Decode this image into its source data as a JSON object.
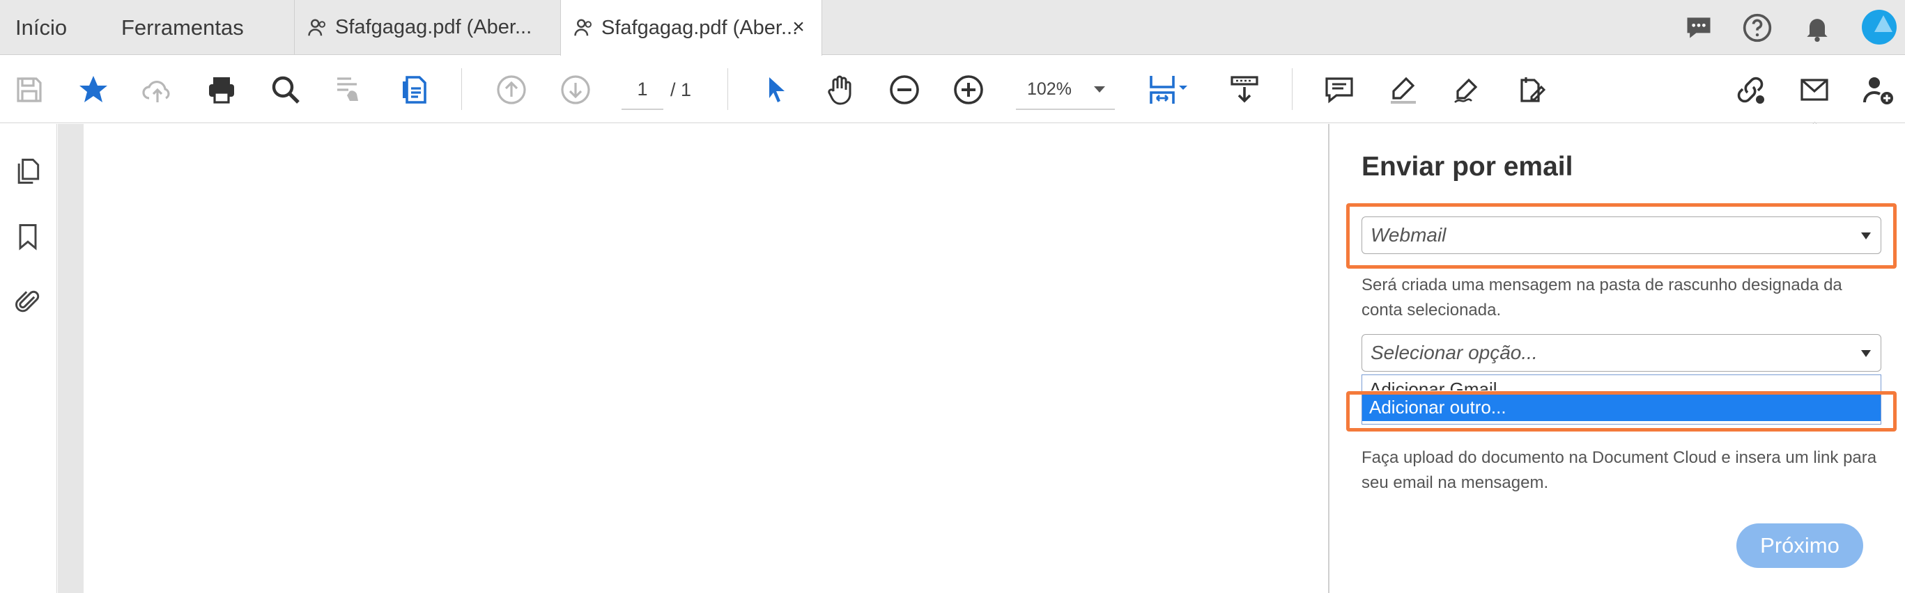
{
  "tabs": {
    "home": "Início",
    "tools": "Ferramentas",
    "doc1": "Sfafgagag.pdf (Aber...",
    "doc2": "Sfafgagag.pdf (Aber...",
    "close_glyph": "×"
  },
  "topbar_icons": [
    "comments-icon",
    "help-icon",
    "notifications-icon",
    "avatar"
  ],
  "toolbar": {
    "page_current": "1",
    "page_total": "/ 1",
    "zoom": "102%"
  },
  "left_rail_icons": [
    "pages-icon",
    "bookmark-icon",
    "attachment-icon"
  ],
  "email_panel": {
    "title": "Enviar por email",
    "provider_value": "Webmail",
    "provider_help": "Será criada uma mensagem na pasta de rascunho designada da conta selecionada.",
    "account_placeholder": "Selecionar opção...",
    "account_options": [
      "Adicionar Gmail",
      "Adicionar outro..."
    ],
    "selected_option_index": 1,
    "cloud_help": "Faça upload do documento na Document Cloud e insera um link para seu email na mensagem.",
    "next_button": "Próximo"
  },
  "colors": {
    "accent_blue": "#1f6fd1",
    "highlight_orange": "#f47a3b",
    "selected_option": "#1e80f0",
    "disabled_button": "#8ab9ef"
  }
}
